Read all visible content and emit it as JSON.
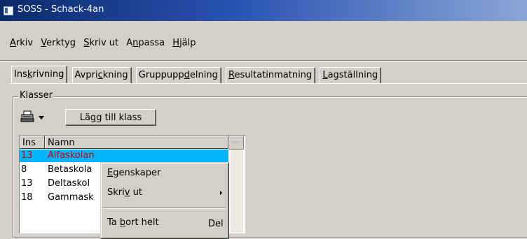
{
  "window": {
    "title": "SOSS - Schack-4an"
  },
  "menu": [
    {
      "pre": "",
      "u": "A",
      "post": "rkiv"
    },
    {
      "pre": "",
      "u": "V",
      "post": "erktyg"
    },
    {
      "pre": "",
      "u": "S",
      "post": "kriv ut"
    },
    {
      "pre": "A",
      "u": "n",
      "post": "passa"
    },
    {
      "pre": "",
      "u": "H",
      "post": "jälp"
    }
  ],
  "tabs": [
    {
      "pre": "Ins",
      "u": "k",
      "post": "rivning",
      "active": true
    },
    {
      "pre": "Avpri",
      "u": "c",
      "post": "kning"
    },
    {
      "pre": "Gruppupp",
      "u": "d",
      "post": "elning"
    },
    {
      "pre": "",
      "u": "R",
      "post": "esultatinmatning"
    },
    {
      "pre": "",
      "u": "L",
      "post": "agställning"
    }
  ],
  "group": {
    "label": "Klasser"
  },
  "toolbar": {
    "print_icon": "printer-icon",
    "add_button": {
      "pre": "Lä",
      "u": "g",
      "post": "g till klass"
    }
  },
  "list": {
    "headers": [
      "Ins",
      "Namn"
    ],
    "rows": [
      {
        "ins": "13",
        "name": "Alfaskolan",
        "selected": true
      },
      {
        "ins": "8",
        "name": "Betaskola"
      },
      {
        "ins": "13",
        "name": "Deltaskol"
      },
      {
        "ins": "18",
        "name": "Gammask"
      }
    ]
  },
  "context_menu": {
    "items": [
      {
        "pre": "",
        "u": "E",
        "post": "genskaper"
      },
      {
        "pre": "Skri",
        "u": "v",
        "post": " ut",
        "submenu": true
      },
      {
        "pre": "Ta ",
        "u": "b",
        "post": "ort helt",
        "shortcut": "Del"
      }
    ]
  },
  "colors": {
    "selection": "#00b4ff",
    "selected_text": "#cc0000",
    "face": "#d4d0c8"
  }
}
